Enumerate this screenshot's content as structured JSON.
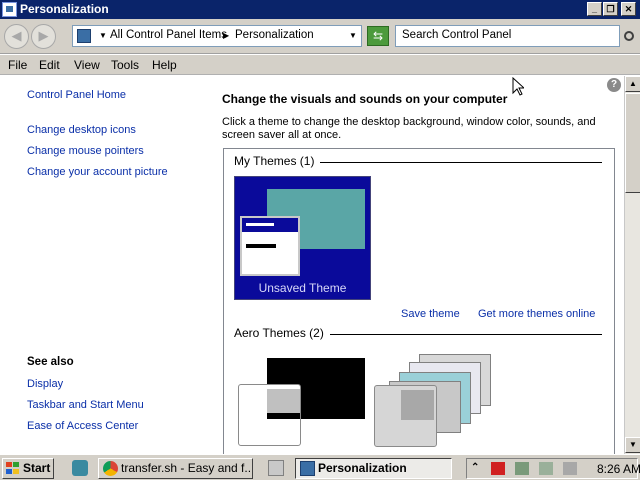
{
  "window": {
    "title": "Personalization",
    "controls": {
      "minimize": "_",
      "maximize": "❐",
      "close": "✕"
    }
  },
  "address_bar": {
    "back_icon": "back-arrow-icon",
    "forward_icon": "forward-arrow-icon",
    "breadcrumb": [
      "All Control Panel Items",
      "Personalization"
    ],
    "search_placeholder": "Search Control Panel"
  },
  "menu": {
    "items": [
      "File",
      "Edit",
      "View",
      "Tools",
      "Help"
    ]
  },
  "left_pane": {
    "home": "Control Panel Home",
    "tasks": [
      "Change desktop icons",
      "Change mouse pointers",
      "Change your account picture"
    ],
    "see_also_title": "See also",
    "see_also": [
      "Display",
      "Taskbar and Start Menu",
      "Ease of Access Center"
    ]
  },
  "main": {
    "heading": "Change the visuals and sounds on your computer",
    "description": "Click a theme to change the desktop background, window color, sounds, and screen saver all at once.",
    "my_themes_title": "My Themes (1)",
    "unsaved_theme": "Unsaved Theme",
    "save_theme": "Save theme",
    "get_more_themes": "Get more themes online",
    "aero_themes_title": "Aero Themes (2)"
  },
  "taskbar": {
    "start": "Start",
    "tasks": [
      {
        "label": "transfer.sh - Easy and f...",
        "icon": "chrome-icon"
      },
      {
        "label": "Personalization",
        "icon": "control-panel-icon",
        "active": true
      }
    ],
    "clock": "8:26 AM"
  },
  "colors": {
    "titlebar": "#0a246a",
    "link": "#0a2fa8",
    "chrome": "#d4d0c8",
    "unsaved_theme_bg": "#0a0a9a",
    "unsaved_theme_window": "#5aa6a6"
  }
}
